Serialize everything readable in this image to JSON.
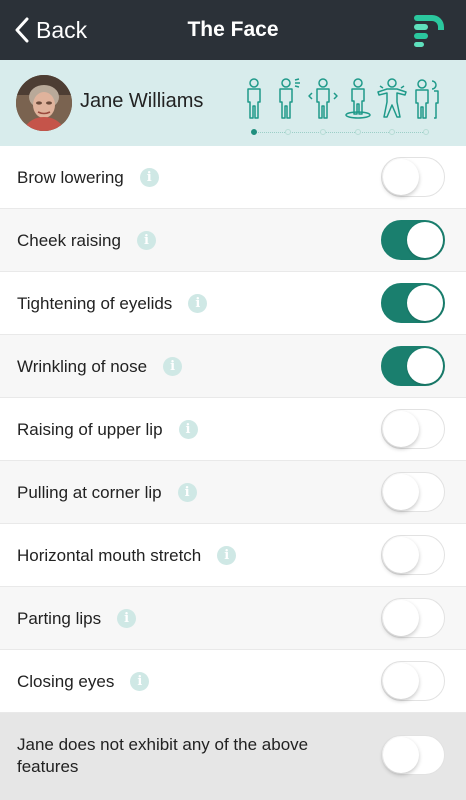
{
  "nav": {
    "back_label": "Back",
    "title": "The Face",
    "logo_icon": "app-logo-icon"
  },
  "patient": {
    "name": "Jane Williams",
    "avatar_icon": "patient-photo"
  },
  "stages": {
    "icons": [
      "person-standing-icon",
      "person-talking-icon",
      "person-arrows-icon",
      "person-platform-icon",
      "person-arms-out-icon",
      "person-pair-icon"
    ],
    "active_index": 0
  },
  "colors": {
    "navbar": "#2b3138",
    "accent": "#1a7f6e",
    "info_icon": "#cfe8e5",
    "patient_bar": "#d8ecec"
  },
  "features": [
    {
      "label": "Brow lowering",
      "on": false
    },
    {
      "label": "Cheek raising",
      "on": true
    },
    {
      "label": "Tightening of eyelids",
      "on": true
    },
    {
      "label": "Wrinkling of nose",
      "on": true
    },
    {
      "label": "Raising of upper lip",
      "on": false
    },
    {
      "label": "Pulling at corner lip",
      "on": false
    },
    {
      "label": "Horizontal mouth stretch",
      "on": false
    },
    {
      "label": "Parting lips",
      "on": false
    },
    {
      "label": "Closing eyes",
      "on": false
    }
  ],
  "none_option": {
    "label": "Jane does not exhibit any of the above features",
    "on": false
  },
  "info_glyph": "i"
}
